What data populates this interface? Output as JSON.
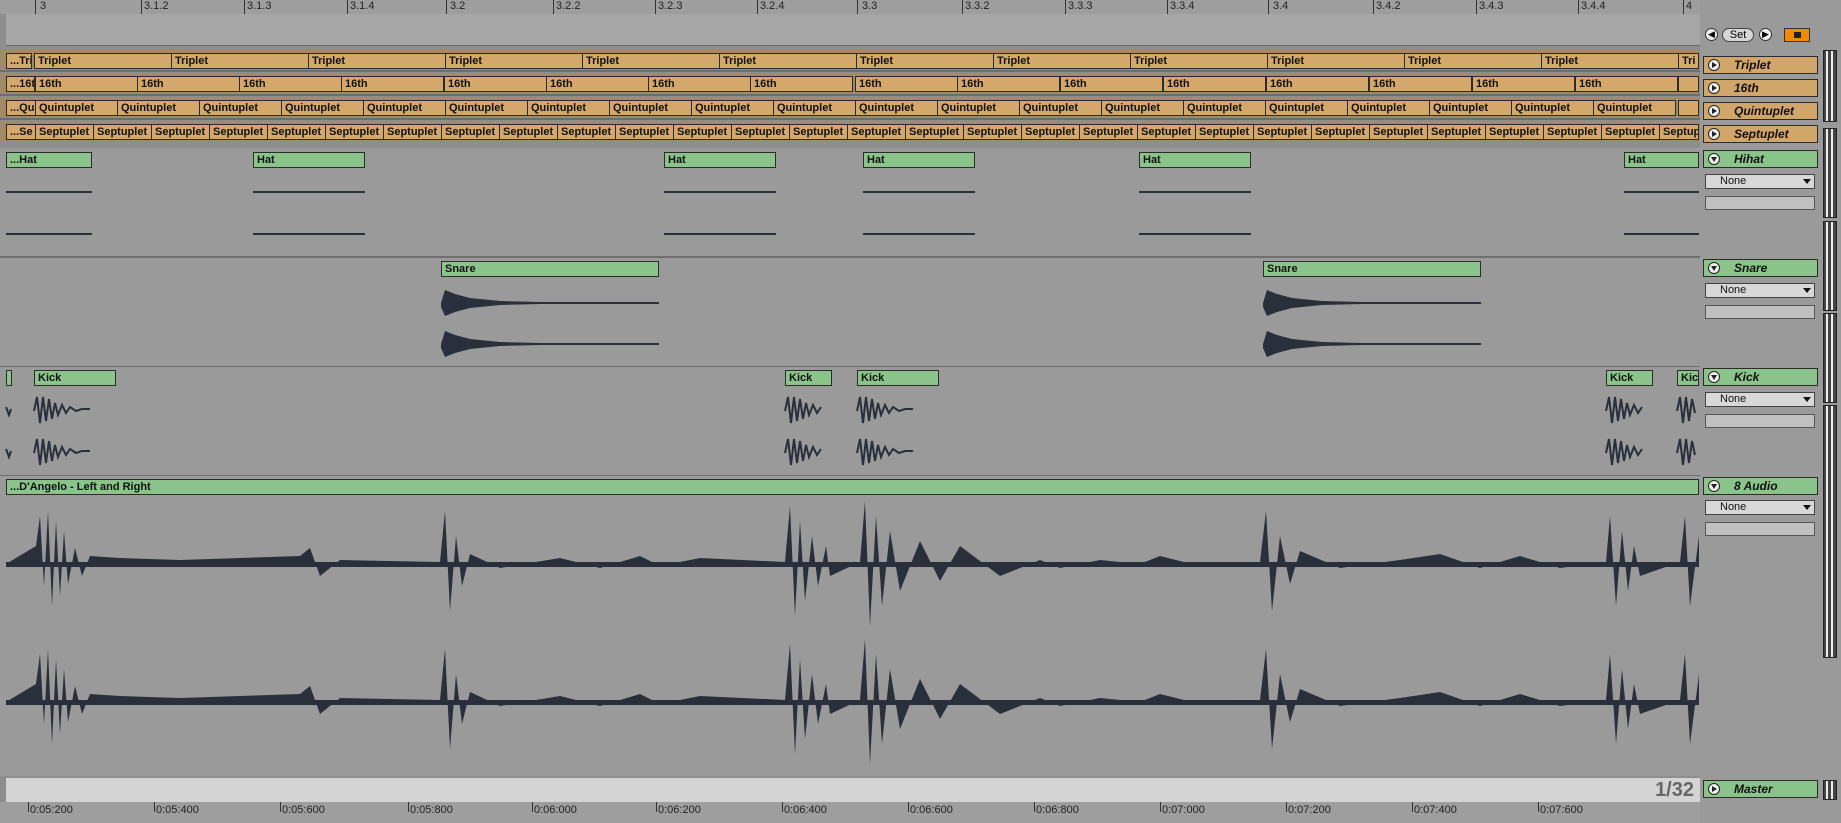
{
  "ruler": {
    "labels": [
      "3",
      "3.1.2",
      "3.1.3",
      "3.1.4",
      "3.2",
      "3.2.2",
      "3.2.3",
      "3.2.4",
      "3.3",
      "3.3.2",
      "3.3.3",
      "3.3.4",
      "3.4",
      "3.4.2",
      "3.4.3",
      "3.4.4",
      "4"
    ]
  },
  "transport": {
    "set_label": "Set",
    "prev_icon": "arrow-left-icon",
    "next_icon": "arrow-right-icon",
    "lock_icon": "lock-icon"
  },
  "tracks": {
    "triplet": {
      "name": "Triplet",
      "clip_label": "Triplet",
      "first_clip": "...Tri",
      "last_clip": "Tri"
    },
    "sixteenth": {
      "name": "16th",
      "clip_label": "16th",
      "first_clip": "...16t"
    },
    "quintuplet": {
      "name": "Quintuplet",
      "clip_label": "Quintuplet",
      "first_clip": "...Qu"
    },
    "septuplet": {
      "name": "Septuplet",
      "clip_label": "Septuplet",
      "first_clip": "...Se"
    },
    "hihat": {
      "name": "Hihat",
      "clips": [
        "...Hat",
        "Hat",
        "Hat",
        "Hat",
        "Hat",
        "Hat"
      ],
      "routing": "None"
    },
    "snare": {
      "name": "Snare",
      "clips": [
        "Snare",
        "Snare"
      ],
      "routing": "None"
    },
    "kick": {
      "name": "Kick",
      "clips": [
        "Kick",
        "Kick",
        "Kick",
        "Kick",
        "Kic"
      ],
      "routing": "None"
    },
    "audio": {
      "name": "8 Audio",
      "clip": "...D'Angelo - Left and Right",
      "routing": "None"
    },
    "master": {
      "name": "Master"
    }
  },
  "grid": {
    "quantization": "1/32"
  },
  "time_axis": {
    "labels": [
      "0:05:200",
      "0:05:400",
      "0:05:600",
      "0:05:800",
      "0:06:000",
      "0:06:200",
      "0:06:400",
      "0:06:600",
      "0:06:800",
      "0:07:000",
      "0:07:200",
      "0:07:400",
      "0:07:600"
    ]
  },
  "colors": {
    "clip_green": "#8ac48a",
    "clip_orange": "#d3a86a",
    "lock_orange": "#f08a00",
    "waveform": "#2a2f3c"
  }
}
